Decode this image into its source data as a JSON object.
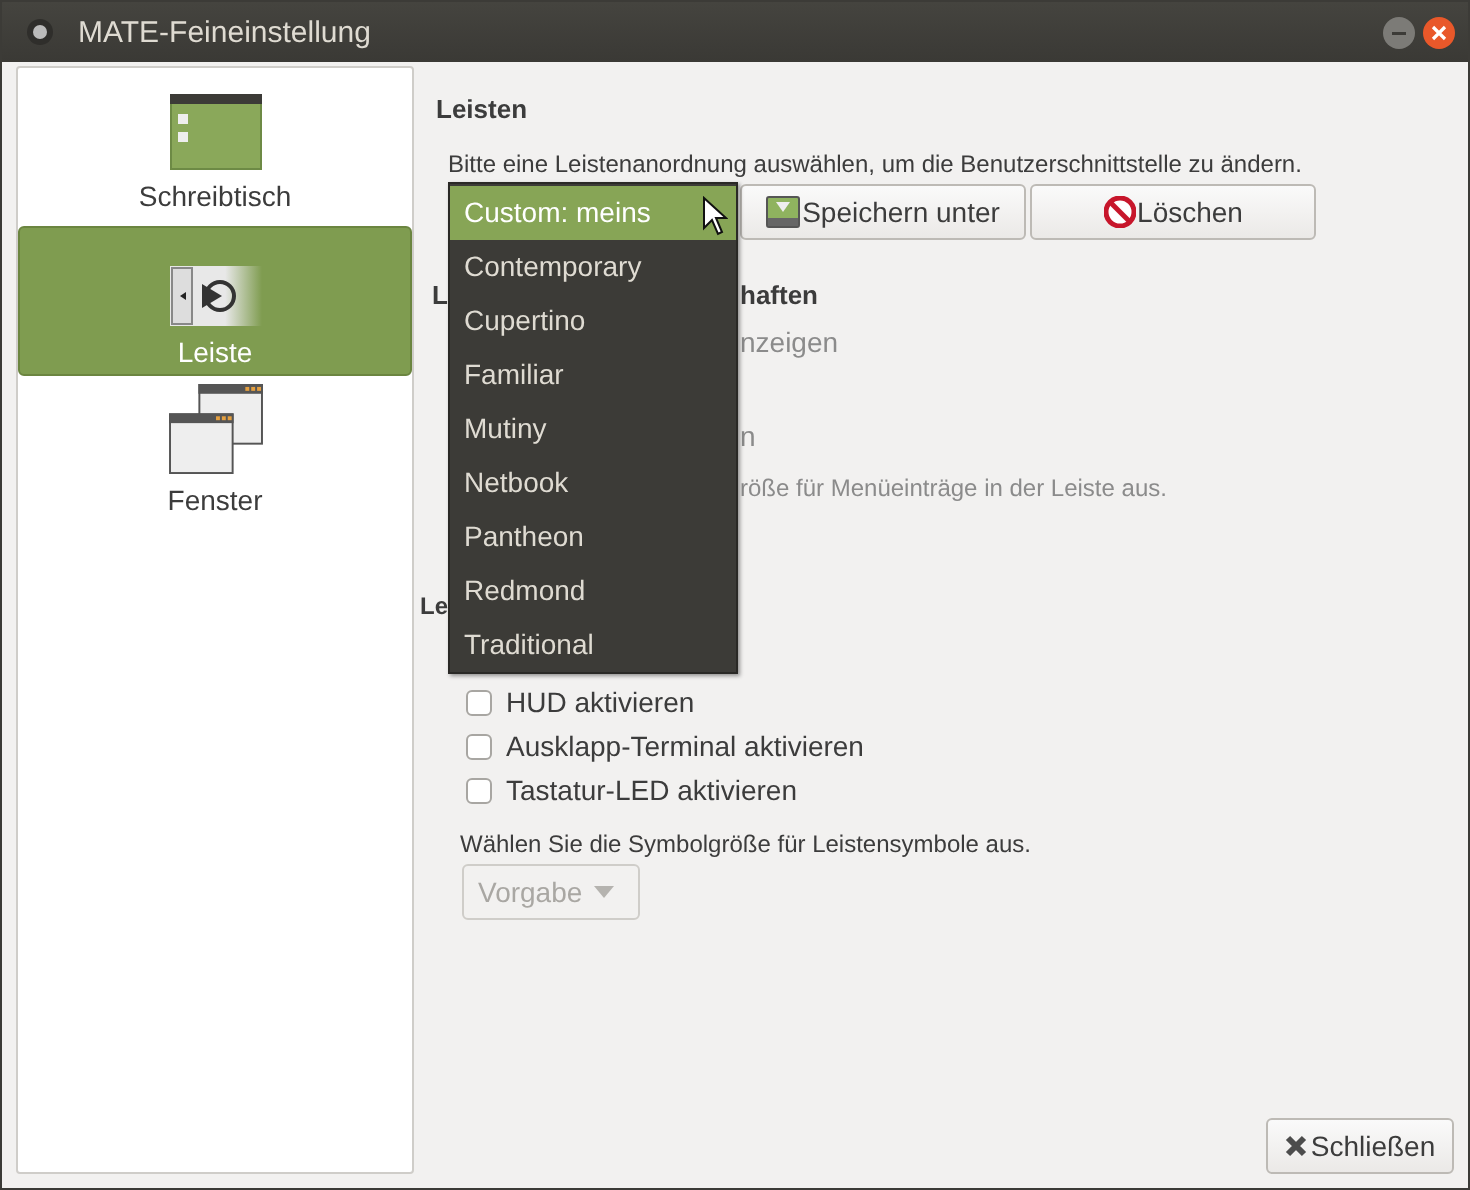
{
  "window": {
    "title": "MATE-Feineinstellung"
  },
  "sidebar": {
    "items": [
      {
        "label": "Schreibtisch",
        "kind": "desktop",
        "selected": false
      },
      {
        "label": "Leiste",
        "kind": "panel",
        "selected": true
      },
      {
        "label": "Fenster",
        "kind": "windows",
        "selected": false
      }
    ]
  },
  "panels": {
    "heading": "Leisten",
    "description": "Bitte eine Leistenanordnung auswählen, um die Benutzerschnittstelle zu ändern.",
    "buttons": [
      {
        "label": "Speichern unter",
        "kind": "save"
      },
      {
        "label": "Löschen",
        "kind": "delete"
      }
    ],
    "layout_menu": {
      "items": [
        {
          "label": "Custom: meins",
          "selected": true
        },
        {
          "label": "Contemporary",
          "selected": false
        },
        {
          "label": "Cupertino",
          "selected": false
        },
        {
          "label": "Familiar",
          "selected": false
        },
        {
          "label": "Mutiny",
          "selected": false
        },
        {
          "label": "Netbook",
          "selected": false
        },
        {
          "label": "Pantheon",
          "selected": false
        },
        {
          "label": "Redmond",
          "selected": false
        },
        {
          "label": "Traditional",
          "selected": false
        }
      ]
    }
  },
  "covered_rows": [
    {
      "kind": "heading",
      "before": "L",
      "after": "haften"
    },
    {
      "kind": "option",
      "after": "nzeigen"
    },
    {
      "kind": "option",
      "after": "n"
    },
    {
      "kind": "hint",
      "after": "röße für Menüeinträge in der Leiste aus."
    },
    {
      "kind": "heading",
      "before": "Le"
    }
  ],
  "options": [
    {
      "label": "HUD aktivieren",
      "checked": false
    },
    {
      "label": "Ausklapp-Terminal aktivieren",
      "checked": false
    },
    {
      "label": "Tastatur-LED aktivieren",
      "checked": false
    }
  ],
  "icon_size": {
    "label": "Wählen Sie die Symbolgröße für Leistensymbole aus.",
    "value": "Vorgabe",
    "disabled": true
  },
  "close_button": {
    "label": "Schließen"
  }
}
